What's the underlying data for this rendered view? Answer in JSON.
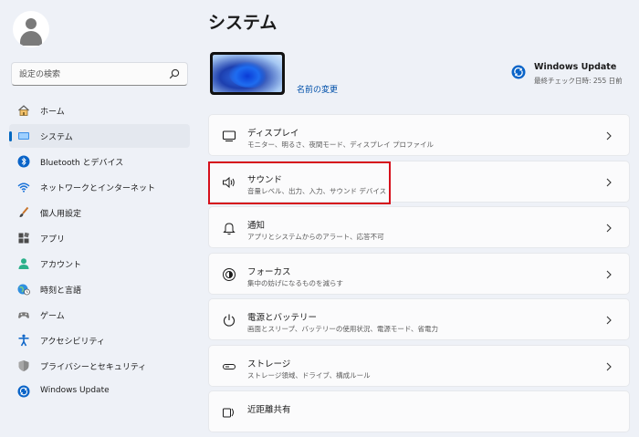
{
  "sidebar": {
    "search": {
      "value": "",
      "placeholder": "設定の検索"
    },
    "items": [
      {
        "label": "ホーム",
        "icon": "home-icon",
        "selected": false
      },
      {
        "label": "システム",
        "icon": "system-display-icon",
        "selected": true
      },
      {
        "label": "Bluetooth とデバイス",
        "icon": "bluetooth-icon",
        "selected": false
      },
      {
        "label": "ネットワークとインターネット",
        "icon": "wifi-icon",
        "selected": false
      },
      {
        "label": "個人用設定",
        "icon": "paintbrush-icon",
        "selected": false
      },
      {
        "label": "アプリ",
        "icon": "apps-icon",
        "selected": false
      },
      {
        "label": "アカウント",
        "icon": "account-icon",
        "selected": false
      },
      {
        "label": "時刻と言語",
        "icon": "globe-clock-icon",
        "selected": false
      },
      {
        "label": "ゲーム",
        "icon": "gamepad-icon",
        "selected": false
      },
      {
        "label": "アクセシビリティ",
        "icon": "accessibility-icon",
        "selected": false
      },
      {
        "label": "プライバシーとセキュリティ",
        "icon": "shield-icon",
        "selected": false
      },
      {
        "label": "Windows Update",
        "icon": "windows-update-icon",
        "selected": false
      }
    ]
  },
  "main": {
    "title": "システム",
    "rename_label": "名前の変更",
    "windows_update": {
      "title": "Windows Update",
      "subtitle": "最終チェック日時: 255 日前"
    },
    "cards": [
      {
        "title": "ディスプレイ",
        "subtitle": "モニター、明るさ、夜間モード、ディスプレイ プロファイル",
        "icon": "monitor-icon"
      },
      {
        "title": "サウンド",
        "subtitle": "音量レベル、出力、入力、サウンド デバイス",
        "icon": "speaker-icon"
      },
      {
        "title": "通知",
        "subtitle": "アプリとシステムからのアラート、応答不可",
        "icon": "bell-icon"
      },
      {
        "title": "フォーカス",
        "subtitle": "集中の妨げになるものを減らす",
        "icon": "focus-icon"
      },
      {
        "title": "電源とバッテリー",
        "subtitle": "画面とスリープ、バッテリーの使用状況、電源モード、省電力",
        "icon": "power-icon"
      },
      {
        "title": "ストレージ",
        "subtitle": "ストレージ領域、ドライブ、構成ルール",
        "icon": "storage-icon"
      },
      {
        "title": "近距離共有",
        "subtitle": "",
        "icon": "nearby-share-icon"
      }
    ]
  },
  "colors": {
    "accent": "#0067c0",
    "highlight": "#d6101c",
    "background": "#eef1f7",
    "card": "#fbfbfc"
  }
}
